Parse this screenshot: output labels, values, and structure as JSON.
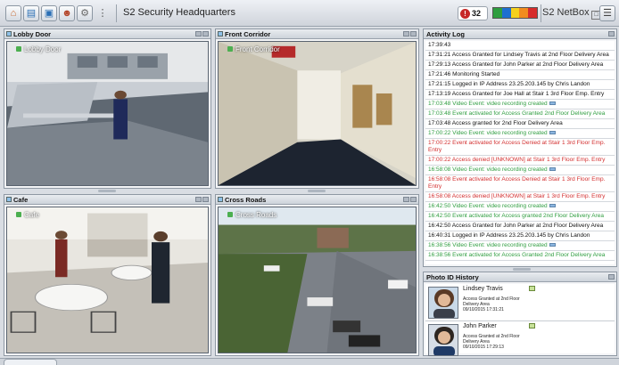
{
  "app": {
    "title": "S2 Security Headquarters"
  },
  "toolbar": {
    "buttons": [
      {
        "name": "home-button",
        "icon": "home-icon"
      },
      {
        "name": "monitor-button",
        "icon": "monitor-icon"
      },
      {
        "name": "display-button",
        "icon": "display-icon"
      },
      {
        "name": "person-button",
        "icon": "person-icon"
      },
      {
        "name": "settings-button",
        "icon": "gear-icon"
      },
      {
        "name": "more-button",
        "icon": "more-vertical-icon"
      }
    ],
    "alarm_count": "32",
    "threat_colors": [
      "#2e9d3f",
      "#1e6fd0",
      "#f6d11d",
      "#f28c1e",
      "#d62c2c"
    ],
    "netbox_label": "S2 NetBox",
    "menu_icon": "hamburger-icon"
  },
  "panes": {
    "lobby": {
      "title": "Lobby Door",
      "cam_label": "Lobby Door"
    },
    "corridor": {
      "title": "Front Corridor",
      "cam_label": "Front Corridor"
    },
    "cafe": {
      "title": "Cafe",
      "cam_label": "Cafe"
    },
    "crossroads": {
      "title": "Cross Roads",
      "cam_label": "Cross Roads"
    }
  },
  "activity_log": {
    "title": "Activity Log",
    "items": [
      {
        "time": "17:39:43",
        "text": "",
        "type": "normal"
      },
      {
        "time": "17:31:21",
        "text": "Access Granted for Lindsey Travis at 2nd Floor Delivery Area",
        "type": "normal"
      },
      {
        "time": "17:29:13",
        "text": "Access Granted for John Parker at 2nd Floor Delivery Area",
        "type": "normal"
      },
      {
        "time": "17:21:46",
        "text": "Monitoring Started",
        "type": "normal"
      },
      {
        "time": "17:21:15",
        "text": "Logged in IP Address 23.25.203.145 by Chris Landon",
        "type": "normal"
      },
      {
        "time": "17:13:19",
        "text": "Access Granted for Joe Hall at Stair 1 3rd Floor Emp. Entry",
        "type": "normal"
      },
      {
        "time": "17:03:48",
        "text": "Video Event: video recording created",
        "type": "video"
      },
      {
        "time": "17:03:48",
        "text": "Event activated for Access Granted 2nd Floor Delivery Area",
        "type": "video"
      },
      {
        "time": "17:03:48",
        "text": "Access granted for 2nd Floor Delivery Area",
        "type": "normal"
      },
      {
        "time": "17:00:22",
        "text": "Video Event: video recording created",
        "type": "video"
      },
      {
        "time": "17:00:22",
        "text": "Event activated for Access Denied at Stair 1 3rd Floor Emp. Entry",
        "type": "denied"
      },
      {
        "time": "17:00:22",
        "text": "Access denied [UNKNOWN] at Stair 1 3rd Floor Emp. Entry",
        "type": "denied"
      },
      {
        "time": "16:58:08",
        "text": "Video Event: video recording created",
        "type": "video"
      },
      {
        "time": "16:58:08",
        "text": "Event activated for Access Denied at Stair 1 3rd Floor Emp. Entry",
        "type": "denied"
      },
      {
        "time": "16:58:08",
        "text": "Access denied [UNKNOWN] at Stair 1 3rd Floor Emp. Entry",
        "type": "denied"
      },
      {
        "time": "16:42:50",
        "text": "Video Event: video recording created",
        "type": "video"
      },
      {
        "time": "16:42:50",
        "text": "Event activated for Access granted 2nd Floor Delivery Area",
        "type": "video"
      },
      {
        "time": "16:42:50",
        "text": "Access Granted for John Parker at 2nd Floor Delivery Area",
        "type": "normal"
      },
      {
        "time": "16:40:31",
        "text": "Logged in IP Address 23.25.203.145 by Chris Landon",
        "type": "normal"
      },
      {
        "time": "16:38:56",
        "text": "Video Event: video recording created",
        "type": "video"
      },
      {
        "time": "16:38:56",
        "text": "Event activated for Access Granted 2nd Floor Delivery Area",
        "type": "video"
      }
    ]
  },
  "photo_history": {
    "title": "Photo ID History",
    "items": [
      {
        "name": "Lindsey Travis",
        "line1": "Access Granted at 2nd Floor",
        "line2": "Delivery Area",
        "line3": "09/10/2015 17:31:21"
      },
      {
        "name": "John Parker",
        "line1": "Access Granted at 2nd Floor",
        "line2": "Delivery Area",
        "line3": "09/10/2015 17:29:13"
      }
    ]
  }
}
